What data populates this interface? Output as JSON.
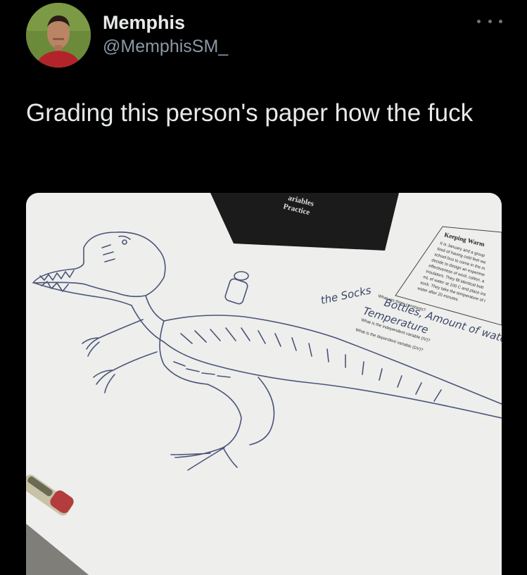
{
  "author": {
    "display_name": "Memphis",
    "handle": "@MemphisSM_"
  },
  "tweet": {
    "text": "Grading this person's paper how the fuck"
  },
  "photo": {
    "worksheet_header": [
      "ariables",
      "Practice"
    ],
    "worksheet_title": "Keeping Warm",
    "worksheet_paragraph": [
      "It is January and a group",
      "tired of having cold feet wa",
      "school bus to come in the m",
      "decide to design an experime",
      "effectiveness of wool, cotton, a",
      "insulators. They fill identical bott",
      "mL of water at 100 C and place ins",
      "sock. They take the temperature of t",
      "water after 20 minutes."
    ],
    "worksheet_questions": [
      "What are three constants?",
      "What is the independent variable (IV)?",
      "What is the dependent variable (DV)?"
    ],
    "handwritten_answers": [
      "Bottles, Amount of water",
      "Temperature",
      "the Socks"
    ]
  },
  "colors": {
    "background": "#000000",
    "text": "#e7e9ea",
    "secondary_text": "#8b98a5"
  }
}
